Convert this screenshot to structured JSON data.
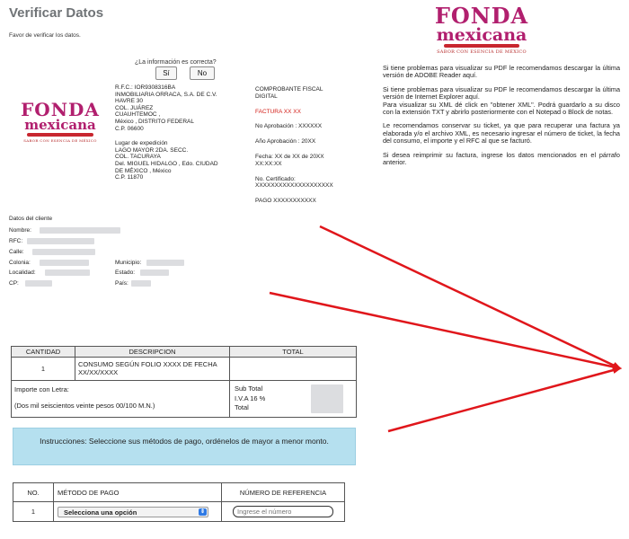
{
  "page": {
    "title": "Verificar Datos",
    "subtitle": "Favor de verificar los datos."
  },
  "confirm": {
    "question": "¿La información es correcta?",
    "yes_label": "Sí",
    "no_label": "No"
  },
  "logo": {
    "word1": "FONDA",
    "word2": "mexicana",
    "tagline": "SABOR CON ESENCIA DE MÉXICO"
  },
  "emisor": {
    "lines": [
      "R.F.C.: IOR9308316BA",
      "INMOBILIARIA ORRACA, S.A. DE C.V.",
      "HAVRE 30",
      "COL. JUÁREZ",
      "CUAUHTEMOC ,",
      "México , DISTRITO FEDERAL",
      "C.P. 06600"
    ],
    "expedicion": [
      "Lugar de expedición",
      "LAGO MAYOR 2DA. SECC.",
      "COL. TACURAYA",
      "Del. MIGUEL HIDALGO , Edo. CIUDAD",
      "DE MÉXICO , México",
      "C.P. 11870"
    ]
  },
  "comprobante": {
    "heading1": "COMPROBANTE FISCAL",
    "heading2": "DIGITAL",
    "factura": "FACTURA XX XX",
    "aprobacion": "No Aprobación : XXXXXX",
    "anio": "Año Aprobación : 20XX",
    "fecha1": "Fecha: XX de XX de 20XX",
    "fecha2": "XX:XX:XX",
    "certificado1": "No. Certificado:",
    "certificado2": "XXXXXXXXXXXXXXXXXXXX",
    "pago": "PAGO XXXXXXXXXXX"
  },
  "info": {
    "paragraphs": [
      "Si tiene problemas para visualizar su PDF le recomendamos descargar la última versión de ADOBE Reader aquí.",
      "Si tiene problemas para visualizar su PDF le recomendamos descargar la última versión de Internet Explorer aquí.",
      "Para visualizar su XML dé click en \"obtener XML\". Podrá guardarlo a su disco con la extensión TXT y abrirlo posteriormente con el Notepad o Block de notas.",
      "Le recomendamos conservar su ticket, ya que para recuperar una factura ya elaborada y/o el archivo XML, es necesario ingresar el número de ticket, la fecha del consumo, el importe y el RFC al que se facturó.",
      "Si desea reimprimir su factura, ingrese los datos mencionados en el párrafo anterior."
    ]
  },
  "cliente": {
    "heading": "Datos del cliente",
    "nombre": "Nombre:",
    "rfc": "RFC:",
    "calle": "Calle:",
    "colonia": "Colonia:",
    "municipio": "Municipio:",
    "localidad": "Localidad:",
    "estado": "Estado:",
    "cp": "CP:",
    "pais": "País:"
  },
  "concepto": {
    "headers": [
      "CANTIDAD",
      "DESCRIPCION",
      "TOTAL"
    ],
    "row": {
      "cantidad": "1",
      "descripcion": "CONSUMO SEGÚN FOLIO XXXX DE FECHA XX/XX/XXXX"
    },
    "importe_label": "Importe con Letra:",
    "importe_texto": "(Dos mil seiscientos veinte pesos 00/100 M.N.)",
    "subtotal": "Sub Total",
    "iva": "I.V.A 16 %",
    "total": "Total"
  },
  "instructions": {
    "text": "Instrucciones: Seleccione sus métodos de pago, ordénelos de mayor a menor monto."
  },
  "pagos": {
    "headers": [
      "NO.",
      "MÉTODO DE PAGO",
      "NÚMERO DE REFERENCIA"
    ],
    "row_no": "1",
    "select_value": "Selecciona una opción",
    "ref_placeholder": "Ingrese el número"
  },
  "colors": {
    "brand": "#b11f6e",
    "accent_red": "#d3201a",
    "instructions_bg": "#b5e0ef",
    "arrow": "#e0161b"
  }
}
